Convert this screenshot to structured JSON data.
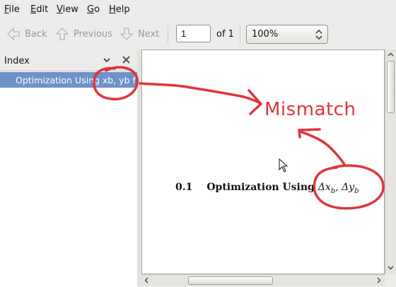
{
  "menu": [
    {
      "label": "File",
      "key": "F",
      "rest": "ile"
    },
    {
      "label": "Edit",
      "key": "E",
      "rest": "dit"
    },
    {
      "label": "View",
      "key": "V",
      "rest": "iew"
    },
    {
      "label": "Go",
      "key": "G",
      "rest": "o"
    },
    {
      "label": "Help",
      "key": "H",
      "rest": "elp"
    }
  ],
  "toolbar": {
    "back_label": "Back",
    "previous_label": "Previous",
    "next_label": "Next",
    "page_value": "1",
    "page_of": "of 1",
    "zoom_value": "100%"
  },
  "sidebar": {
    "title": "Index",
    "items": [
      {
        "label": "Optimization Using xb, yb  f"
      }
    ]
  },
  "document": {
    "section_number": "0.1",
    "section_title": "Optimization Using",
    "section_math": "Δx_b, Δy_b"
  },
  "annotation": {
    "text": "Mismatch",
    "color": "#e2333a"
  }
}
